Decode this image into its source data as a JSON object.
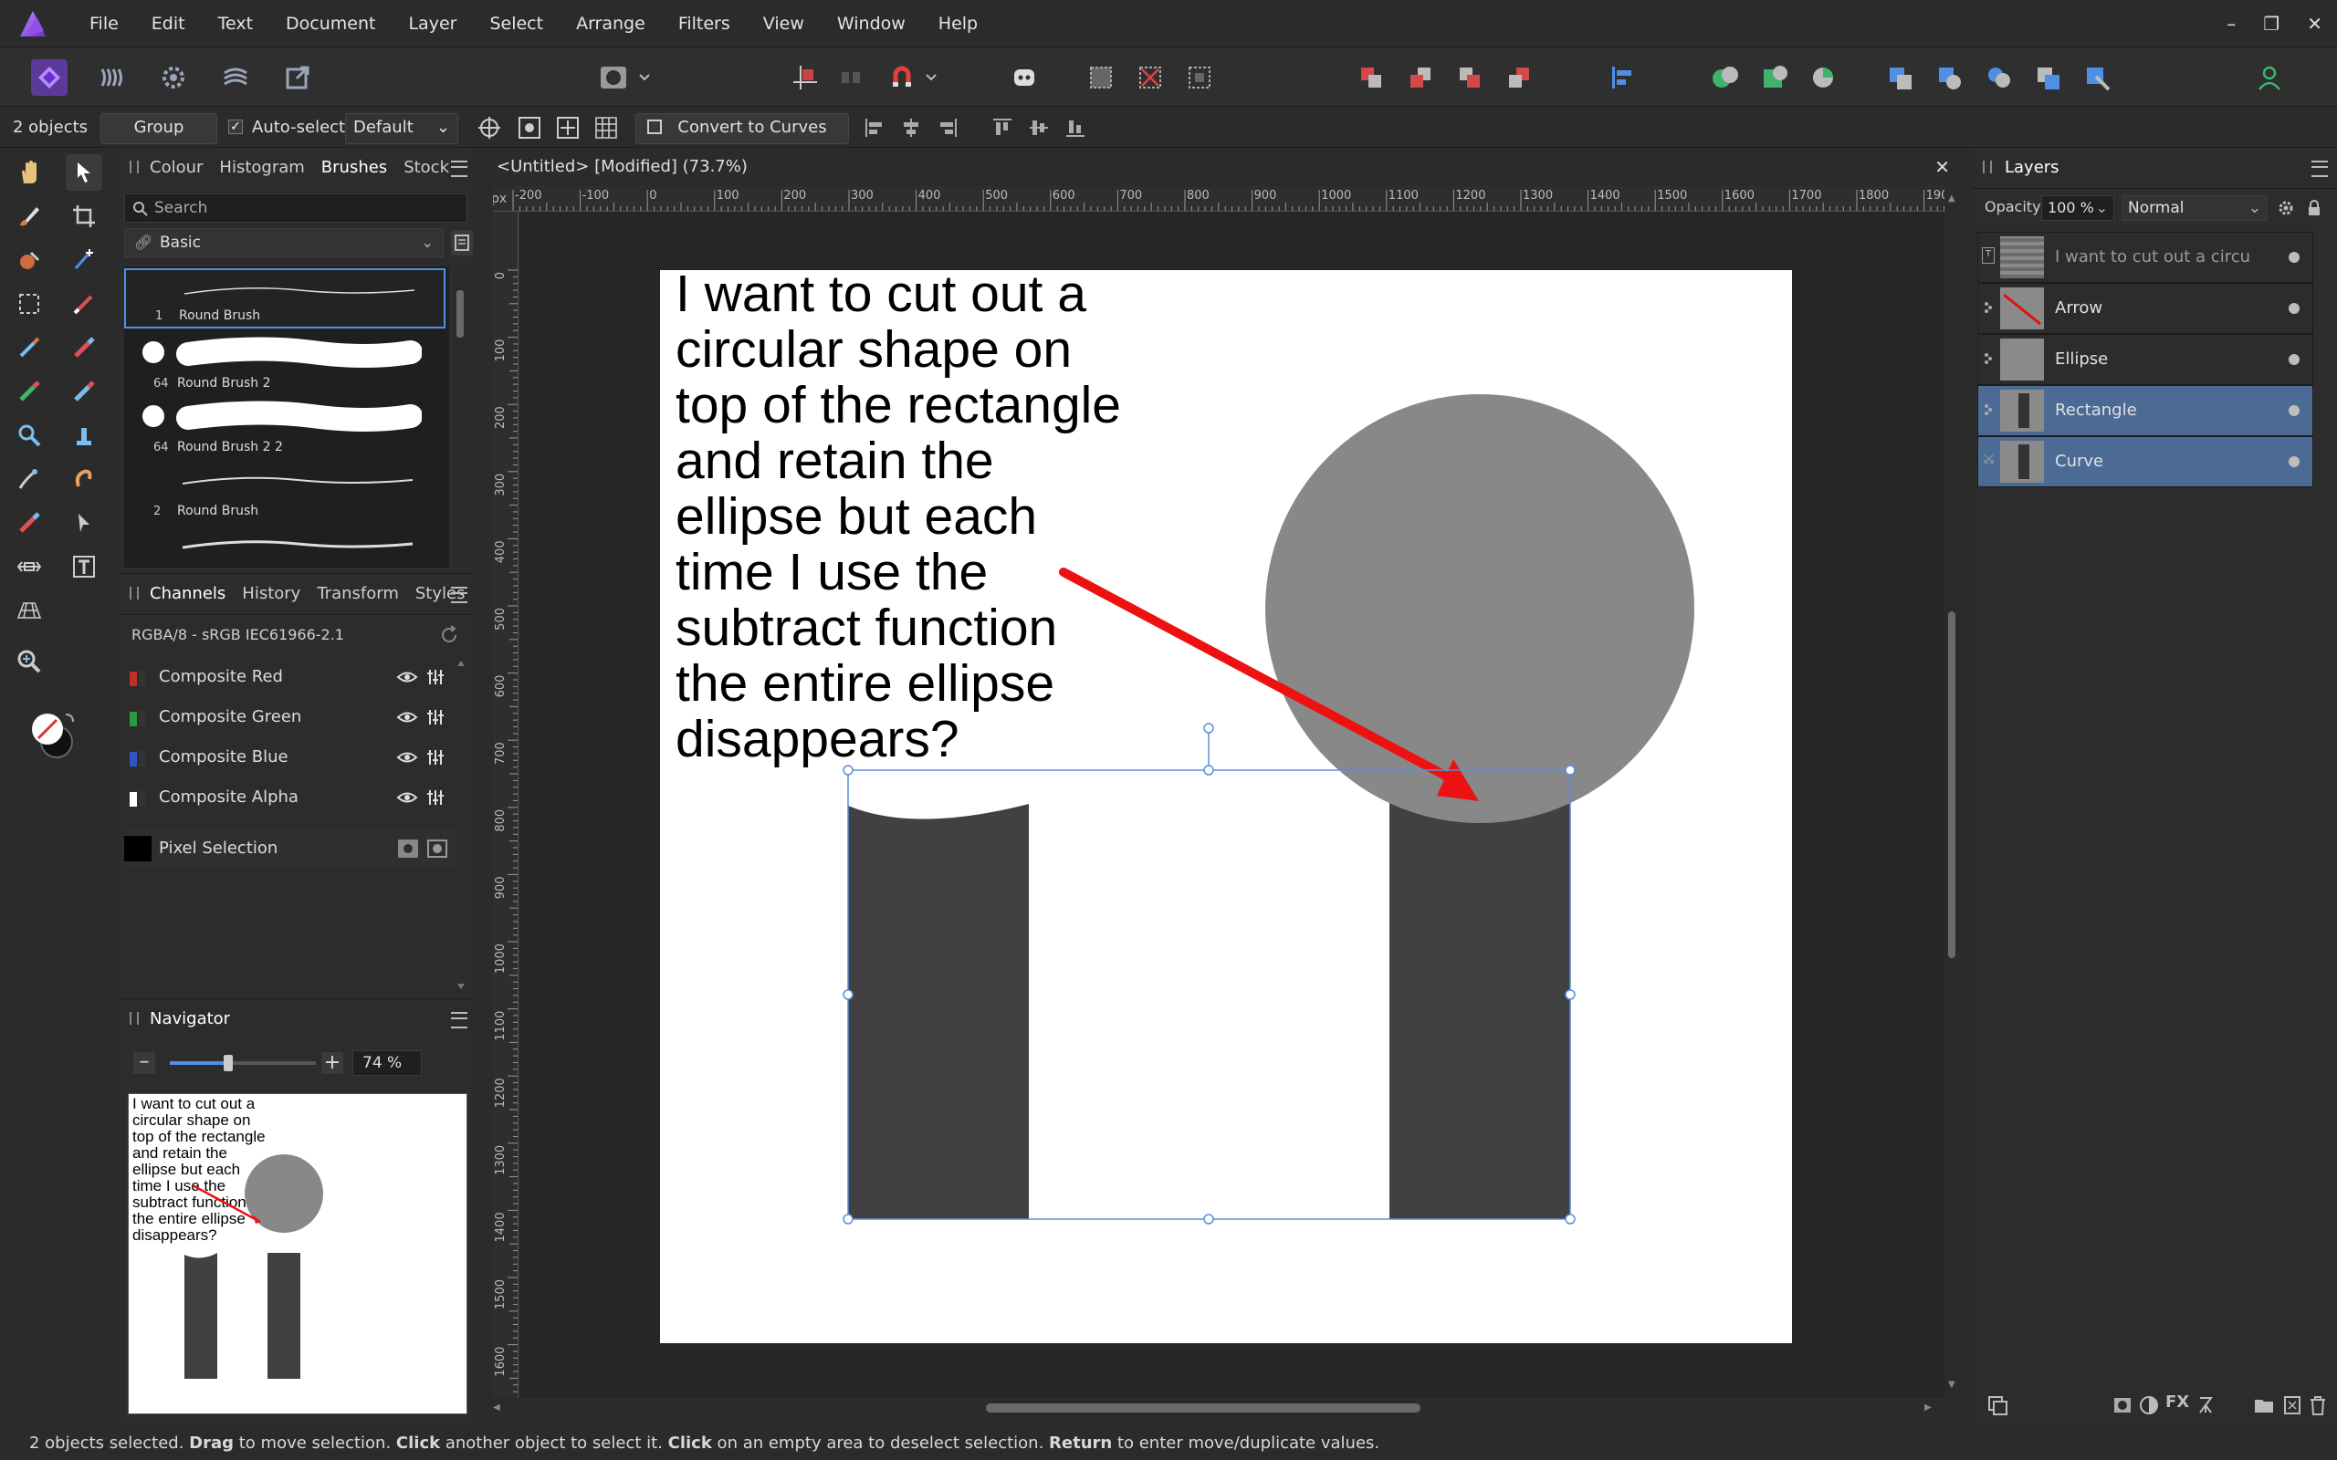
{
  "app": {
    "name": "Affinity Photo"
  },
  "menu": [
    "File",
    "Edit",
    "Text",
    "Document",
    "Layer",
    "Select",
    "Arrange",
    "Filters",
    "View",
    "Window",
    "Help"
  ],
  "context_bar": {
    "selection_count": "2 objects",
    "group_label": "Group",
    "autoselect_label": "Auto-select:",
    "autoselect_value": "Default",
    "convert_label": "Convert to Curves"
  },
  "brushes_panel": {
    "tabs": [
      "Colour",
      "Histogram",
      "Brushes",
      "Stock"
    ],
    "active_tab": "Brushes",
    "search_placeholder": "Search",
    "category": "Basic",
    "brushes": [
      {
        "num": "1",
        "name": "Round Brush"
      },
      {
        "num": "64",
        "name": "Round Brush 2"
      },
      {
        "num": "64",
        "name": "Round Brush 2 2"
      },
      {
        "num": "2",
        "name": "Round Brush"
      }
    ]
  },
  "channels_panel": {
    "tabs": [
      "Channels",
      "History",
      "Transform",
      "Styles"
    ],
    "active_tab": "Channels",
    "profile": "RGBA/8 - sRGB IEC61966-2.1",
    "channels": [
      "Composite Red",
      "Composite Green",
      "Composite Blue",
      "Composite Alpha"
    ],
    "pixel_selection": "Pixel Selection",
    "channel_colors": [
      "#c0302a",
      "#2f9a3a",
      "#2e55c8",
      "#ffffff"
    ]
  },
  "navigator_panel": {
    "title": "Navigator",
    "zoom": "74 %",
    "zoom_fraction": 0.4
  },
  "document": {
    "title": "<Untitled> [Modified] (73.7%)",
    "ruler_unit": "px",
    "hruler_labels": [
      "-200",
      "-100",
      "0",
      "100",
      "200",
      "300",
      "400",
      "500",
      "600",
      "700",
      "800",
      "900",
      "1000",
      "1100",
      "1200",
      "1300",
      "1400",
      "1500",
      "1600",
      "1700",
      "1800",
      "190"
    ],
    "vruler_labels": [
      "0",
      "100",
      "200",
      "300",
      "400",
      "500",
      "600",
      "700",
      "800",
      "900",
      "1000",
      "1100",
      "1200",
      "1300",
      "1400",
      "1500",
      "1600"
    ],
    "text_lines": [
      "I want to cut out a",
      "circular shape on",
      "top of the rectangle",
      "and retain the",
      "ellipse but each",
      "time I use the",
      "subtract function",
      "the entire ellipse",
      "disappears?"
    ],
    "colors": {
      "rect": "#414141",
      "ellipse": "#888888",
      "arrow": "#ee1111",
      "page": "#ffffff",
      "selection": "#5a8fd6"
    }
  },
  "layers_panel": {
    "title": "Layers",
    "opacity_label": "Opacity:",
    "opacity_value": "100 %",
    "blend_mode": "Normal",
    "layers": [
      {
        "name": "I want to cut out a circu",
        "selected": false
      },
      {
        "name": "Arrow",
        "selected": false
      },
      {
        "name": "Ellipse",
        "selected": false
      },
      {
        "name": "Rectangle",
        "selected": true
      },
      {
        "name": "Curve",
        "selected": true
      }
    ]
  },
  "status_bar": {
    "parts": [
      {
        "text": "2 objects selected. ",
        "bold": false
      },
      {
        "text": "Drag",
        "bold": true
      },
      {
        "text": " to move selection. ",
        "bold": false
      },
      {
        "text": "Click",
        "bold": true
      },
      {
        "text": " another object to select it. ",
        "bold": false
      },
      {
        "text": "Click",
        "bold": true
      },
      {
        "text": " on an empty area to deselect selection. ",
        "bold": false
      },
      {
        "text": "Return",
        "bold": true
      },
      {
        "text": " to enter move/duplicate values.",
        "bold": false
      }
    ]
  }
}
